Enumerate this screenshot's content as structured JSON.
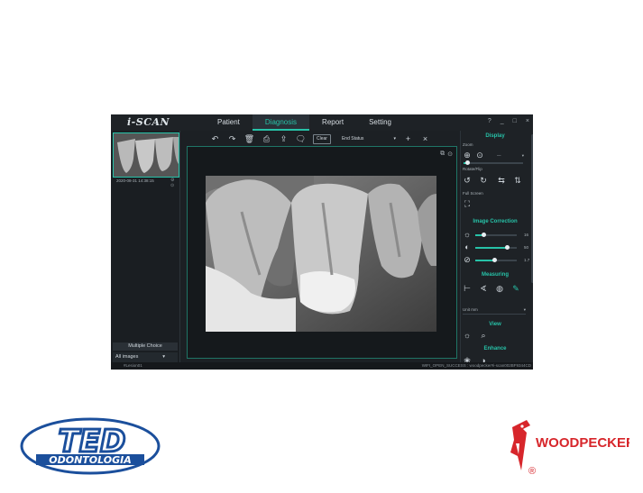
{
  "app": {
    "logo": "i-SCAN",
    "tabs": [
      "Patient",
      "Diagnosis",
      "Report",
      "Setting"
    ],
    "active_tab": "Diagnosis",
    "window_controls": [
      "?",
      "_",
      "□",
      "×"
    ]
  },
  "left_panel": {
    "thumbnail_date": "2020-08-31 14:38:15",
    "multiple_choice": "Multiple Choice",
    "all_images": "All images"
  },
  "toolbar": {
    "clear_label": "Clear",
    "status_label": "End Status"
  },
  "right_panel": {
    "display_title": "Display",
    "zoom_label": "Zoom",
    "zoom_value": "—",
    "rotate_label": "Rotate/Flip",
    "fullscreen_label": "Full Screen",
    "image_correction_title": "Image Correction",
    "brightness_value": "16",
    "contrast_value": "50",
    "gamma_value": "1.7",
    "brightness_level": 0.2,
    "contrast_level": 0.75,
    "gamma_level": 0.45,
    "measuring_title": "Measuring",
    "unit_label": "Unit",
    "unit_value": "mm",
    "view_title": "View",
    "enhance_title": "Enhance"
  },
  "statusbar": {
    "left": "#Lesion01",
    "right": "WIFI_OPEN_SUCCESS : woodpecker#i-scan002BF9344CD"
  },
  "logos": {
    "ted_main": "TED",
    "ted_sub": "ODONTOLOGIA",
    "woodpecker": "WOODPECKER",
    "registered": "®"
  },
  "colors": {
    "accent": "#27c2a8",
    "app_bg": "#1c2024",
    "ted_blue": "#1b4f9c",
    "woodpecker_red": "#d7262b"
  }
}
